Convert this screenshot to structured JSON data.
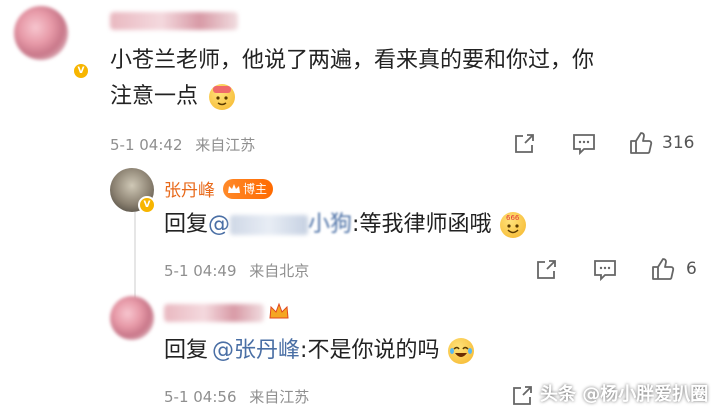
{
  "comment": {
    "text_line1": "小苍兰老师，他说了两遍，看来真的要和你过，你",
    "text_line2": "注意一点",
    "emoji_icon": "sweat-worker-emoji-icon",
    "time": "5-1 04:42",
    "source": "来自江苏",
    "like_count": "316"
  },
  "reply1": {
    "author": "张丹峰",
    "badge": "博主",
    "prefix": "回复",
    "at": "@",
    "mention_suffix": "小狗",
    "body": ":等我律师函哦",
    "emoji_icon": "666-emoji-icon",
    "time": "5-1 04:49",
    "source": "来自北京",
    "like_count": "6"
  },
  "reply2": {
    "prefix": "回复",
    "mention": "@张丹峰",
    "body": ":不是你说的吗",
    "emoji_icon": "laugh-cry-emoji-icon",
    "time": "5-1 04:56",
    "source": "来自江苏"
  },
  "watermark": {
    "text": "头条 @杨小胖爱扒圈"
  },
  "colors": {
    "author": "#e8691a",
    "mention": "#4a6fa5",
    "meta": "#8f8f8f"
  }
}
